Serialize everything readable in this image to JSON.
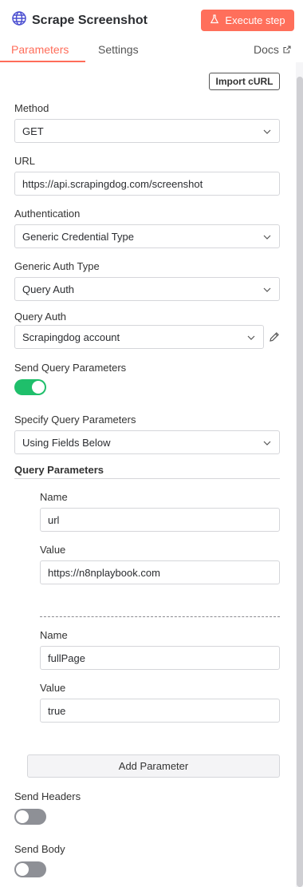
{
  "header": {
    "title": "Scrape Screenshot",
    "execute_label": "Execute step",
    "icon": "globe-icon"
  },
  "tabs": [
    {
      "label": "Parameters",
      "active": true
    },
    {
      "label": "Settings",
      "active": false
    }
  ],
  "docs_label": "Docs",
  "import_label": "Import cURL",
  "method": {
    "label": "Method",
    "value": "GET"
  },
  "url": {
    "label": "URL",
    "value": "https://api.scrapingdog.com/screenshot"
  },
  "authentication": {
    "label": "Authentication",
    "value": "Generic Credential Type"
  },
  "generic_auth_type": {
    "label": "Generic Auth Type",
    "value": "Query Auth"
  },
  "query_auth": {
    "label": "Query Auth",
    "value": "Scrapingdog account"
  },
  "send_query_params": {
    "label": "Send Query Parameters",
    "enabled": true
  },
  "specify_query_params": {
    "label": "Specify Query Parameters",
    "value": "Using Fields Below"
  },
  "query_parameters": {
    "heading": "Query Parameters",
    "items": [
      {
        "name_label": "Name",
        "name_value": "url",
        "value_label": "Value",
        "value_value": "https://n8nplaybook.com"
      },
      {
        "name_label": "Name",
        "name_value": "fullPage",
        "value_label": "Value",
        "value_value": "true"
      }
    ],
    "add_label": "Add Parameter"
  },
  "send_headers": {
    "label": "Send Headers",
    "enabled": false
  },
  "send_body": {
    "label": "Send Body",
    "enabled": false
  },
  "colors": {
    "accent": "#ff6d5a",
    "execute_bg": "#ff6f5b",
    "toggle_on": "#1fbf6b",
    "toggle_off": "#8e9096"
  }
}
